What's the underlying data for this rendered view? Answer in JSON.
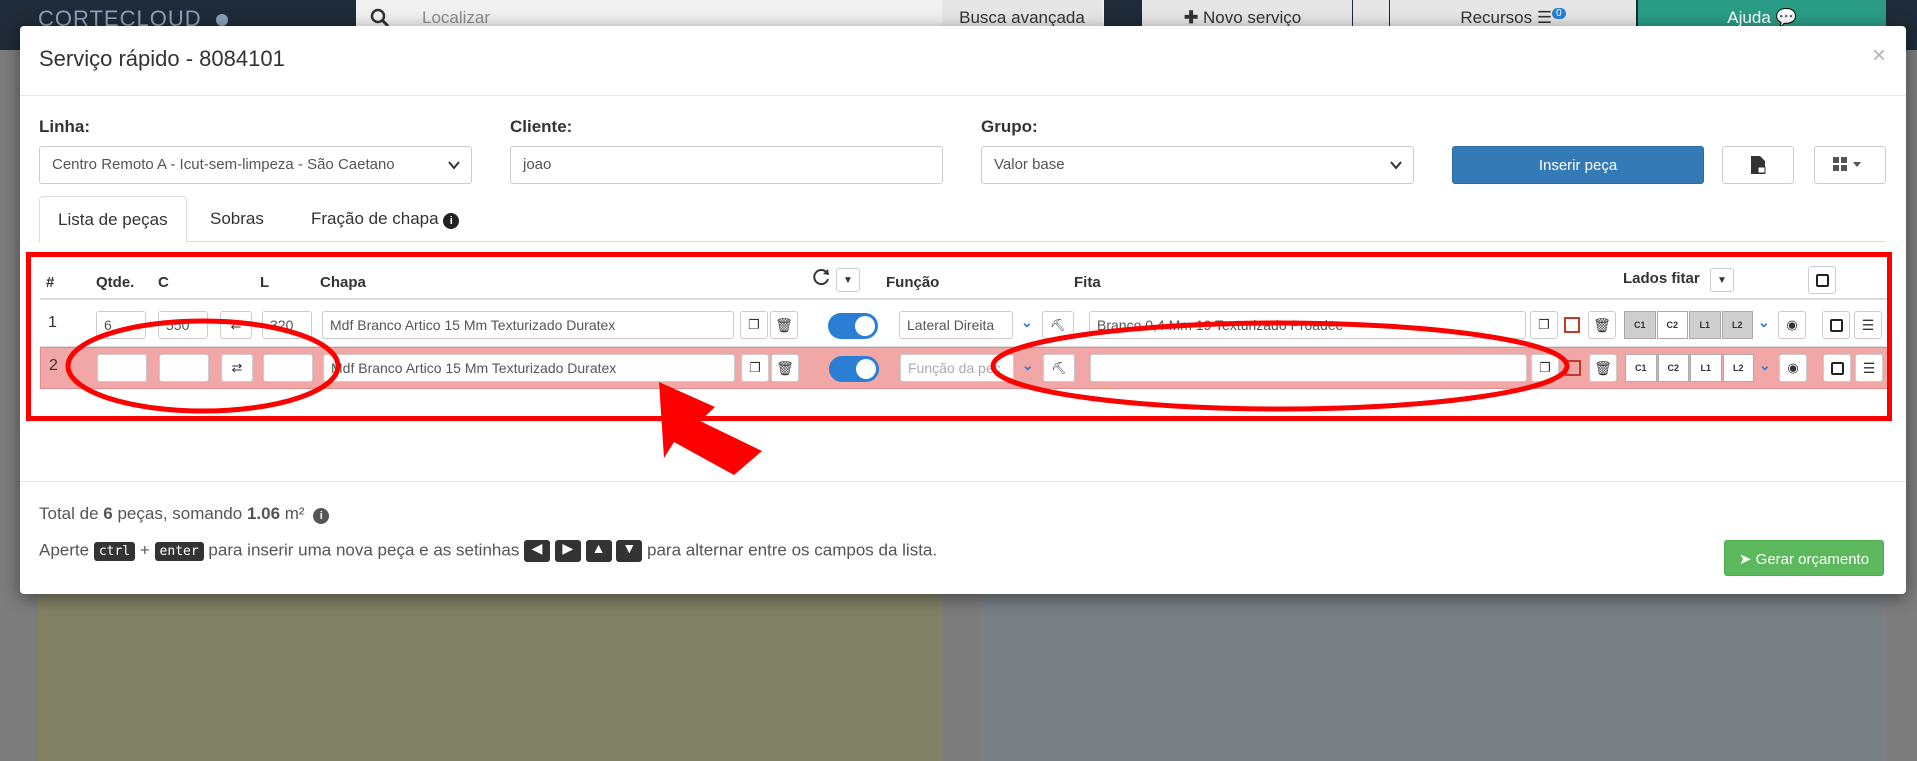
{
  "background": {
    "brand": "CORTECLOUD",
    "search_placeholder": "Localizar",
    "advanced_search": "Busca avançada",
    "new_service": "Novo serviço",
    "resources": "Recursos",
    "resources_badge": "0",
    "help": "Ajuda"
  },
  "modal": {
    "title": "Serviço rápido - 8084101",
    "close": "×",
    "linha_label": "Linha:",
    "linha_value": "Centro Remoto A - Icut-sem-limpeza - São Caetano",
    "cliente_label": "Cliente:",
    "cliente_value": "joao",
    "grupo_label": "Grupo:",
    "grupo_value": "Valor base",
    "insert_button": "Inserir peça"
  },
  "tabs": [
    {
      "label": "Lista de peças"
    },
    {
      "label": "Sobras"
    },
    {
      "label": "Fração de chapa"
    }
  ],
  "table": {
    "headers": {
      "num": "#",
      "qtde": "Qtde.",
      "c": "C",
      "l": "L",
      "chapa": "Chapa",
      "funcao": "Função",
      "fita": "Fita",
      "lados": "Lados fitar"
    },
    "rows": [
      {
        "num": "1",
        "qtde": "6",
        "c": "550",
        "l": "320",
        "chapa": "Mdf Branco Artico 15 Mm Texturizado Duratex",
        "funcao": "Lateral Direita",
        "fita": "Branco 0,4 Mm 19 Texturizado Proadec"
      },
      {
        "num": "2",
        "qtde": "",
        "c": "",
        "l": "",
        "chapa": "Mdf Branco Artico 15 Mm Texturizado Duratex",
        "funcao_placeholder": "Função da peç",
        "fita": ""
      }
    ],
    "sides": [
      "C1",
      "C2",
      "L1",
      "L2"
    ]
  },
  "footer": {
    "total_prefix": "Total de ",
    "total_count": "6",
    "total_mid": " peças, somando ",
    "total_area": "1.06",
    "total_unit": " m²",
    "hint_1": "Aperte",
    "kbd_ctrl": "ctrl",
    "plus": "+",
    "kbd_enter": "enter",
    "hint_2": "para inserir uma nova peça e as setinhas",
    "hint_3": "para alternar entre os campos da lista.",
    "generate_button": "Gerar orçamento"
  }
}
